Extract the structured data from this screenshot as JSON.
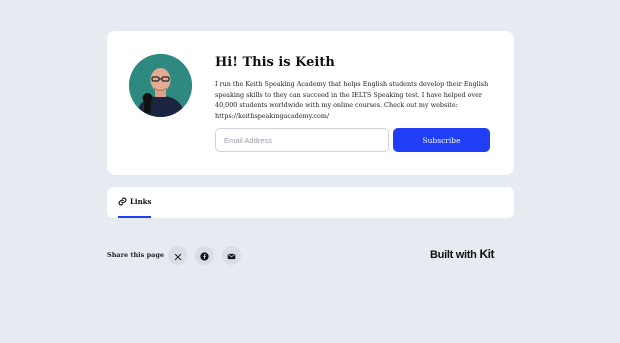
{
  "profile": {
    "avatar_alt": "Keith profile photo",
    "title": "Hi! This is Keith",
    "bio": "I run the Keith Speaking Academy that helps English students develop their English speaking skills to they can succeed in the IELTS Speaking test. I have helped over 40,000 students worldwide with my online courses. Check out my website: https://keithspeakingacademy.com/"
  },
  "subscribe_form": {
    "email_placeholder": "Email Address",
    "email_value": "",
    "button_label": "Subscribe"
  },
  "tabs": [
    {
      "label": "Links",
      "icon": "link-icon",
      "active": true
    }
  ],
  "share": {
    "label": "Share this page",
    "buttons": [
      {
        "icon": "x-icon"
      },
      {
        "icon": "facebook-icon"
      },
      {
        "icon": "mail-icon"
      }
    ]
  },
  "footer": {
    "built_with": "Built with",
    "brand": "Kit"
  },
  "colors": {
    "background": "#e6eaf1",
    "card": "#ffffff",
    "accent": "#1f3ef5",
    "avatar_bg": "#2e8a80",
    "share_button_bg": "#d9dde4"
  }
}
